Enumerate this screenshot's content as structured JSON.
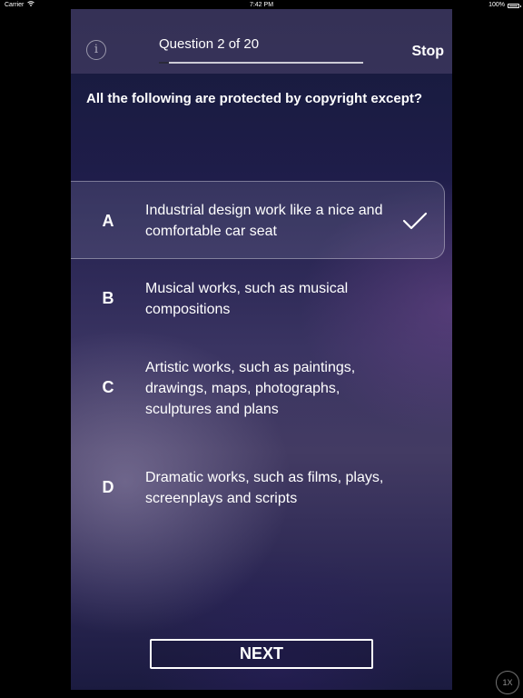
{
  "status_bar": {
    "carrier": "Carrier",
    "time": "7:42 PM",
    "battery_text": "100%",
    "battery_level": 1.0,
    "wifi_icon": "wifi-icon"
  },
  "header": {
    "info_icon": "info-icon",
    "info_glyph": "i",
    "progress_label": "Question 2 of 20",
    "progress_fraction": 0.05,
    "stop_label": "Stop"
  },
  "question": {
    "text": "All the following are protected by copyright except?"
  },
  "options": [
    {
      "letter": "A",
      "text": "Industrial design work like a nice and comfortable car seat",
      "selected": true
    },
    {
      "letter": "B",
      "text": "Musical works, such as musical compositions",
      "selected": false
    },
    {
      "letter": "C",
      "text": "Artistic works, such as paintings, drawings, maps, photographs, sculptures and plans",
      "selected": false
    },
    {
      "letter": "D",
      "text": "Dramatic works, such as films, plays, screenplays and scripts",
      "selected": false
    }
  ],
  "footer": {
    "next_label": "NEXT",
    "speed_label": "1X"
  },
  "colors": {
    "background": "#000000",
    "text": "#ffffff",
    "panel_top": "#151a3a",
    "panel_mid": "#433b63"
  }
}
